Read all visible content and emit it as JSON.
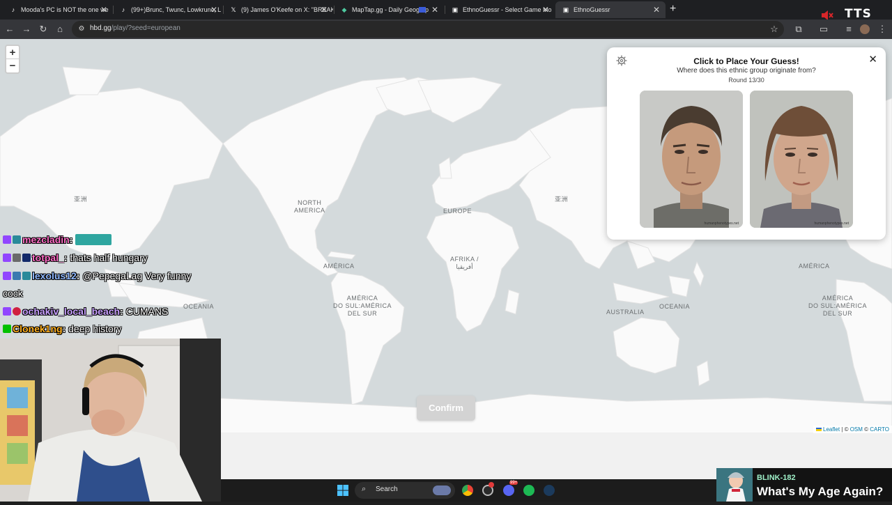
{
  "browser": {
    "tabs": [
      {
        "title": "Mooda's PC is NOT the one we",
        "icon": "tiktok-icon"
      },
      {
        "title": "(99+)Brunc, Twunc, Lowkrunc, L",
        "icon": "tiktok-icon"
      },
      {
        "title": "(9) James O'Keefe on X: \"BREAK",
        "icon": "x-icon"
      },
      {
        "title": "MapTap.gg - Daily Geograp",
        "icon": "maptap-icon"
      },
      {
        "title": "EthnoGuessr - Select Game Mo",
        "icon": "ethnoguessr-icon"
      },
      {
        "title": "EthnoGuessr",
        "icon": "ethnoguessr-icon",
        "active": true
      }
    ],
    "new_tab": "+",
    "url_host": "hbd.gg",
    "url_path": "/play/?seed=european",
    "overlay_badge": "TTS"
  },
  "map": {
    "zoom_in": "+",
    "zoom_out": "−",
    "labels": {
      "asia_left": "亚洲",
      "asia_right": "亚洲",
      "north_america": "NORTH\nAMERICA",
      "europe": "EUROPE",
      "america_left": "AMÉRICA",
      "africa": "AFRIKA /\nأفريقيا",
      "america_right": "AMÉRICA",
      "south_america_left": "AMÉRICA\nDO SUL:AMÉRICA\nDEL SUR",
      "south_america_right": "AMÉRICA\nDO SUL:AMÉRICA\nDEL SUR",
      "oceania_left": "OCEANIA",
      "australia": "AUSTRALIA",
      "oceania_right": "OCEANIA"
    },
    "attribution": {
      "leaflet": "Leaflet",
      "sep": " | © ",
      "osm": "OSM",
      "sep2": " © ",
      "carto": "CARTO"
    }
  },
  "panel": {
    "title": "Click to Place Your Guess!",
    "subtitle": "Where does this ethnic group originate from?",
    "round": "Round 13/30",
    "close": "✕",
    "image_caption_left": "humanphenotypes.net",
    "image_caption_right": "humanphenotypes.net"
  },
  "confirm_label": "Confirm",
  "chat": [
    {
      "user": "mezcladin",
      "sep": ":",
      "message": "",
      "user_color": "#ff6ec7"
    },
    {
      "user": "totpal_",
      "sep": ":",
      "message": " thats half hungary",
      "user_color": "#ff6ec7"
    },
    {
      "user": "lexolus12",
      "sep": ":",
      "message": " @PepegaLag Very funny",
      "user_color": "#8fb8ff"
    },
    {
      "user": "",
      "sep": "",
      "message": "cock",
      "user_color": "#ffffff"
    },
    {
      "user": "ochakiv_local_beach",
      "sep": ":",
      "message": " CUMANS",
      "user_color": "#c9a0ff"
    },
    {
      "user": "Clonek1ng",
      "sep": ":",
      "message": " deep history",
      "user_color": "#ffb020"
    }
  ],
  "taskbar": {
    "search": "Search",
    "notification_badge": "99+"
  },
  "now_playing": {
    "artist": "BLINK-182",
    "title": "What's My Age Again?"
  }
}
